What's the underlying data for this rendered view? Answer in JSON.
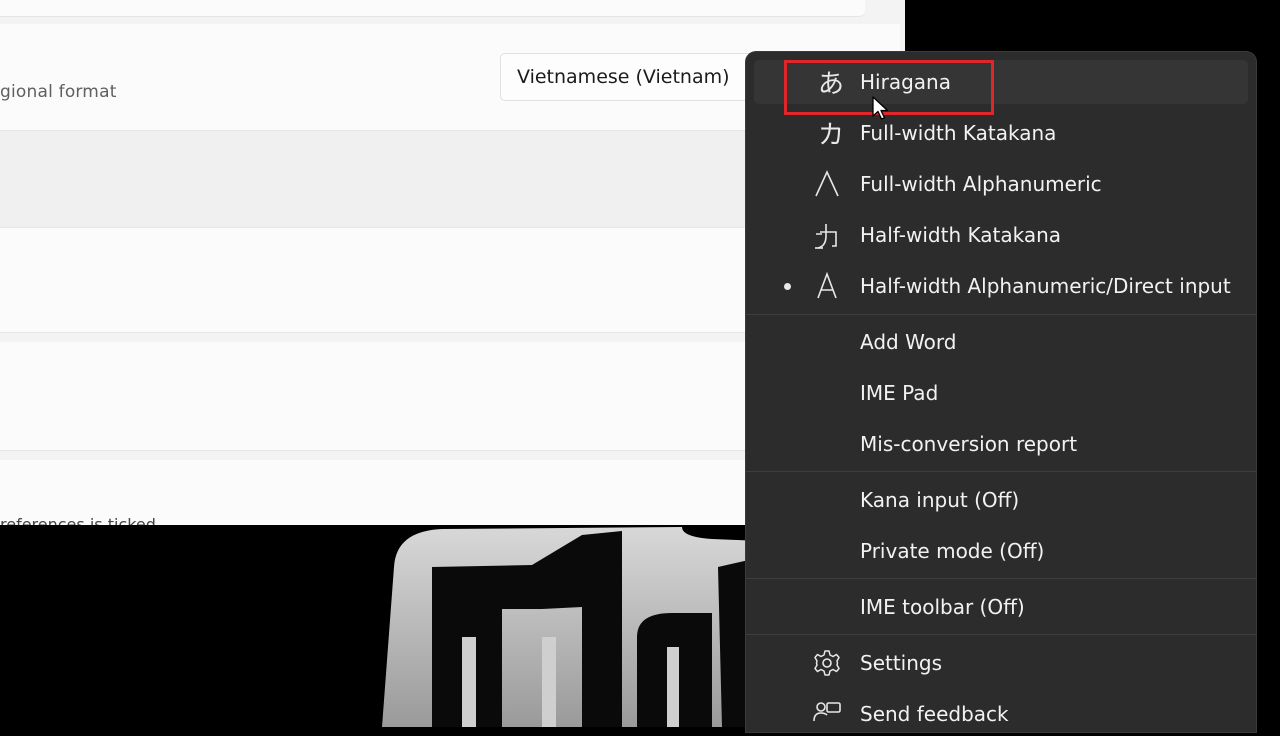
{
  "settings": {
    "region_label": "gional format",
    "region_value": "Vietnamese (Vietnam)",
    "cut_text": "references is ticked"
  },
  "ime_menu": {
    "input_modes": [
      {
        "glyph": "あ",
        "label": "Hiragana"
      },
      {
        "glyph": "カ",
        "label": "Full-width Katakana"
      },
      {
        "glyph": "A",
        "label": "Full-width Alphanumeric"
      },
      {
        "glyph": "ｶ",
        "label": "Half-width Katakana"
      },
      {
        "glyph": "A",
        "label": "Half-width Alphanumeric/Direct input"
      }
    ],
    "tools": [
      {
        "label": "Add Word"
      },
      {
        "label": "IME Pad"
      },
      {
        "label": "Mis-conversion report"
      }
    ],
    "toggles": [
      {
        "label": "Kana input (Off)"
      },
      {
        "label": "Private mode (Off)"
      }
    ],
    "toolbar": {
      "label": "IME toolbar (Off)"
    },
    "settings": {
      "label": "Settings",
      "icon": "gear-icon"
    },
    "feedback": {
      "label": "Send feedback",
      "icon": "feedback-icon"
    },
    "highlight_color": "#e0262b"
  }
}
